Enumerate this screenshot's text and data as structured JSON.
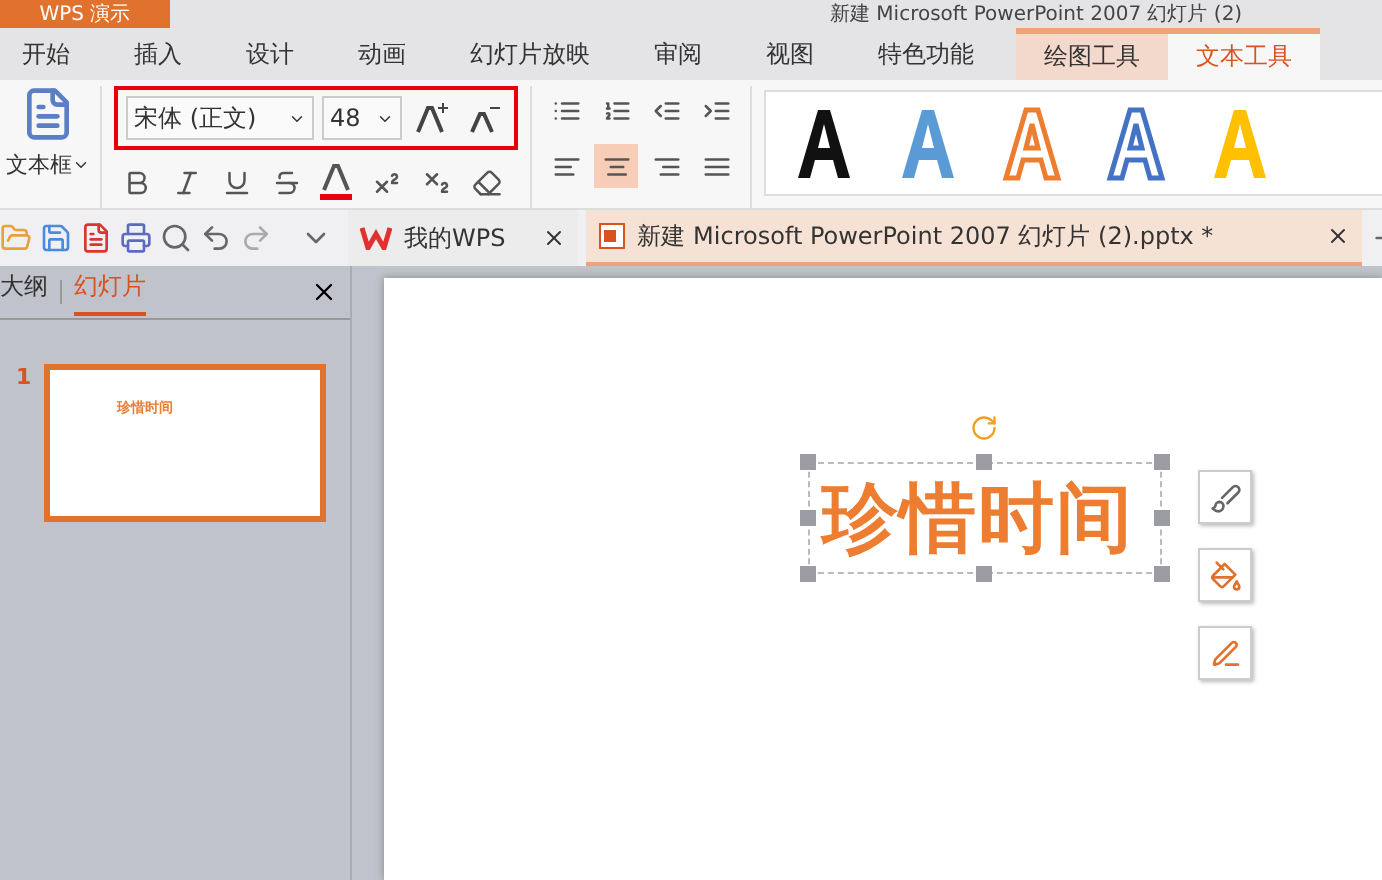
{
  "app_button": {
    "label": "WPS 演示"
  },
  "window": {
    "title": "新建 Microsoft PowerPoint 2007 幻灯片 (2)"
  },
  "tabs": [
    {
      "label": "开始",
      "selected": false
    },
    {
      "label": "插入",
      "selected": false
    },
    {
      "label": "设计",
      "selected": false
    },
    {
      "label": "动画",
      "selected": false
    },
    {
      "label": "幻灯片放映",
      "selected": false
    },
    {
      "label": "审阅",
      "selected": false
    },
    {
      "label": "视图",
      "selected": false
    },
    {
      "label": "特色功能",
      "selected": false
    },
    {
      "label": "绘图工具",
      "selected": false,
      "kind": "context"
    },
    {
      "label": "文本工具",
      "selected": true,
      "kind": "context"
    }
  ],
  "ribbon": {
    "textbox_button": "文本框",
    "font_name": "宋体 (正文)",
    "font_size": "48",
    "align": [
      {
        "kind": "left",
        "selected": false
      },
      {
        "kind": "center",
        "selected": true
      },
      {
        "kind": "right",
        "selected": false
      },
      {
        "kind": "justify",
        "selected": false
      }
    ],
    "styles": [
      {
        "kind": "solid",
        "color": "#111111"
      },
      {
        "kind": "soft",
        "color": "#5b9bd5"
      },
      {
        "kind": "outline",
        "color": "#ed7d31"
      },
      {
        "kind": "outline",
        "color": "#4472c4"
      },
      {
        "kind": "solid",
        "color": "#ffc000"
      }
    ]
  },
  "doc_tabs": [
    {
      "label": "我的WPS",
      "selected": false,
      "kind": "home"
    },
    {
      "label": "新建 Microsoft PowerPoint 2007 幻灯片 (2).pptx *",
      "selected": true,
      "kind": "doc"
    }
  ],
  "panel": {
    "tabs": [
      {
        "label": "大纲",
        "selected": false
      },
      {
        "label": "幻灯片",
        "selected": true
      }
    ],
    "slides": [
      {
        "number": "1",
        "title": "珍惜时间",
        "selected": true
      }
    ]
  },
  "slide": {
    "text": "珍惜时间",
    "color": "#ed7d31"
  }
}
